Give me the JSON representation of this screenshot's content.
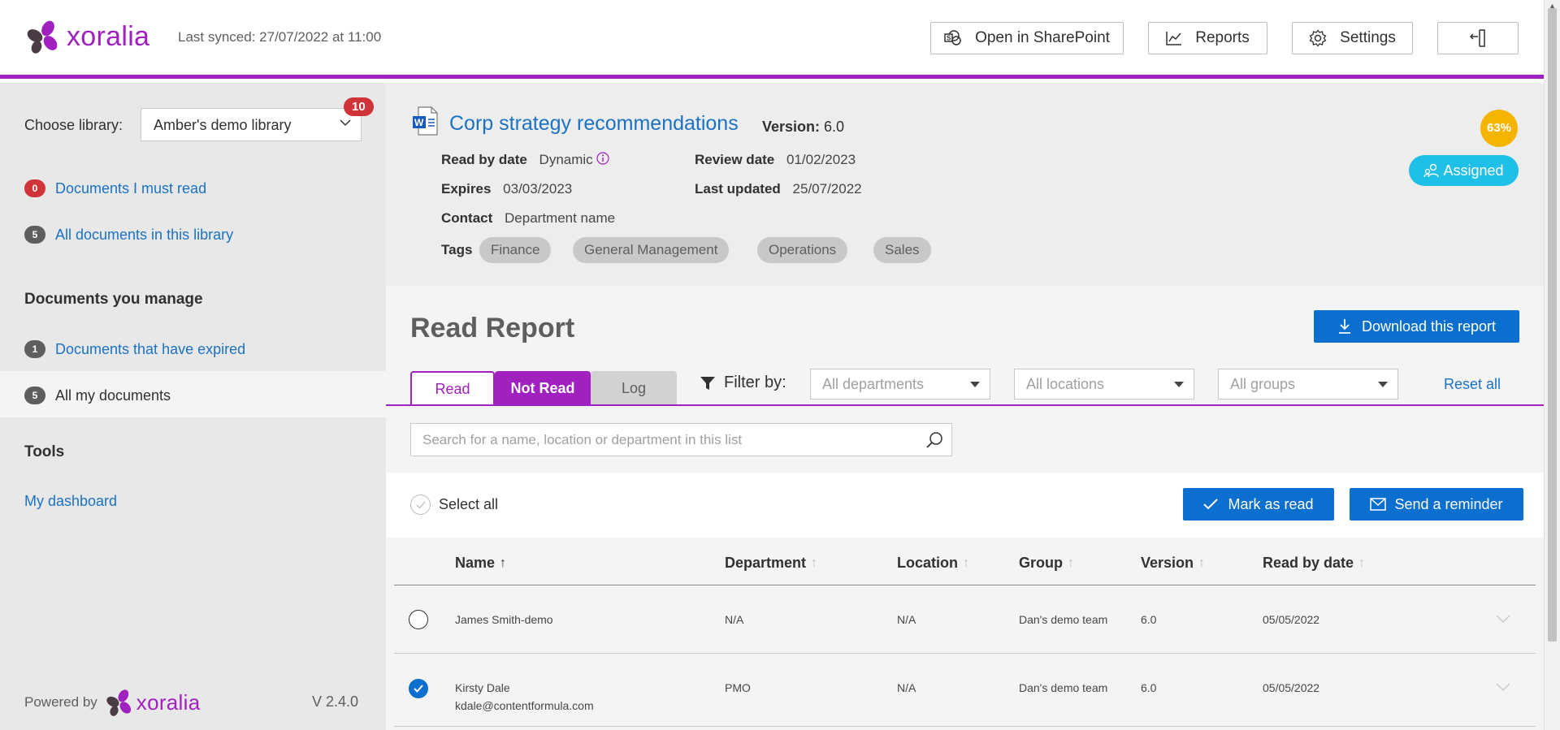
{
  "header": {
    "logo_text": "xoralia",
    "last_synced": "Last synced: 27/07/2022 at 11:00",
    "buttons": {
      "sharepoint": "Open in SharePoint",
      "reports": "Reports",
      "settings": "Settings"
    },
    "icons": {
      "sharepoint": "sharepoint-icon",
      "reports": "chart-line-icon",
      "settings": "gear-icon",
      "exit": "sign-out-icon"
    }
  },
  "sidebar": {
    "choose_library_label": "Choose library:",
    "library_value": "Amber's demo library",
    "library_badge": "10",
    "links": [
      {
        "count": "0",
        "label": "Documents I must read"
      },
      {
        "count": "5",
        "label": "All documents in this library"
      }
    ],
    "manage_heading": "Documents you manage",
    "manage_links": [
      {
        "count": "1",
        "label": "Documents that have expired"
      },
      {
        "count": "5",
        "label": "All my documents"
      }
    ],
    "tools_heading": "Tools",
    "dashboard_link": "My dashboard",
    "powered_by": "Powered by",
    "powered_logo": "xoralia",
    "version": "V 2.4.0"
  },
  "document": {
    "title": "Corp strategy recommendations",
    "version_label": "Version:",
    "version_value": "6.0",
    "read_by_date_label": "Read by date",
    "read_by_date_value": "Dynamic",
    "review_date_label": "Review date",
    "review_date_value": "01/02/2023",
    "expires_label": "Expires",
    "expires_value": "03/03/2023",
    "last_updated_label": "Last updated",
    "last_updated_value": "25/07/2022",
    "contact_label": "Contact",
    "contact_value": "Department name",
    "tags_label": "Tags",
    "tags": [
      "Finance",
      "General Management",
      "Operations",
      "Sales"
    ],
    "percent": "63%",
    "assigned_label": "Assigned"
  },
  "report": {
    "title": "Read Report",
    "download_label": "Download this report",
    "tabs": [
      "Read",
      "Not Read",
      "Log"
    ],
    "active_tab": "Not Read",
    "filter_label": "Filter by:",
    "filters": [
      "All departments",
      "All locations",
      "All groups"
    ],
    "reset_label": "Reset all",
    "search_placeholder": "Search for a name, location or department in this list"
  },
  "actions": {
    "select_all": "Select all",
    "mark_as_read": "Mark as read",
    "send_reminder": "Send a reminder"
  },
  "table": {
    "columns": [
      "Name",
      "Department",
      "Location",
      "Group",
      "Version",
      "Read by date"
    ],
    "rows": [
      {
        "name": "James Smith-demo",
        "email": "",
        "department": "N/A",
        "location": "N/A",
        "group": "Dan's demo team",
        "version": "6.0",
        "read_by": "05/05/2022",
        "checked": false
      },
      {
        "name": "Kirsty Dale",
        "email": "kdale@contentformula.com",
        "department": "PMO",
        "location": "N/A",
        "group": "Dan's demo team",
        "version": "6.0",
        "read_by": "05/05/2022",
        "checked": true
      }
    ]
  },
  "colors": {
    "brand_purple": "#a020c0",
    "link_blue": "#1b72c4",
    "button_blue": "#0b6fd0",
    "badge_red": "#d13438",
    "percent_yellow": "#f4b400",
    "assigned_cyan": "#1ec0e8"
  }
}
